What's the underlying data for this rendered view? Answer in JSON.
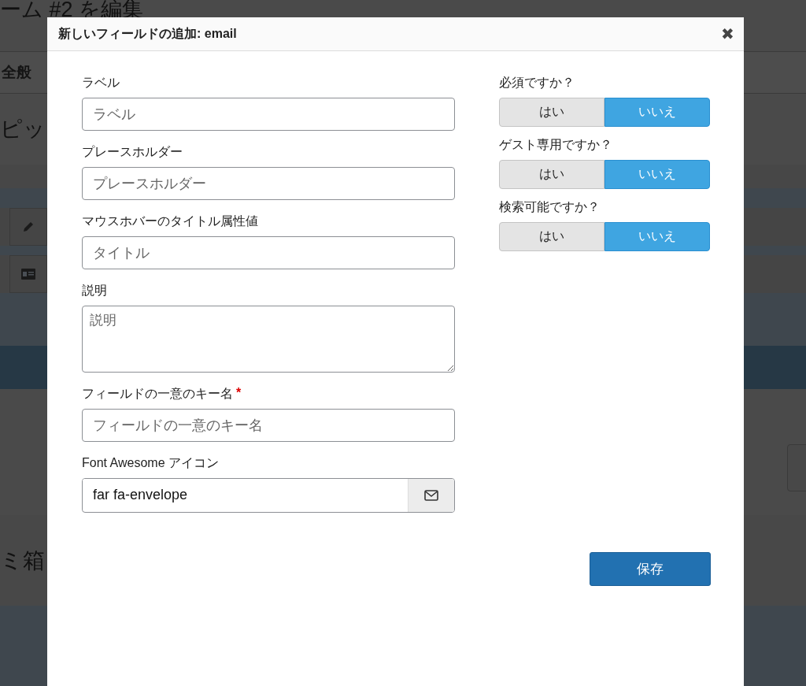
{
  "background": {
    "page_title": "ーム #2 を編集",
    "tab": "全般",
    "section_heading": "ピッ",
    "trash_heading": "ミ箱"
  },
  "dialog": {
    "title": "新しいフィールドの追加: email",
    "close": "✖",
    "fields": [
      {
        "kind": "input",
        "label": "ラベル",
        "placeholder": "ラベル"
      },
      {
        "kind": "input",
        "label": "プレースホルダー",
        "placeholder": "プレースホルダー"
      },
      {
        "kind": "input",
        "label": "マウスホバーのタイトル属性値",
        "placeholder": "タイトル"
      },
      {
        "kind": "textarea",
        "label": "説明",
        "placeholder": "説明"
      },
      {
        "kind": "input",
        "label": "フィールドの一意のキー名",
        "required_mark": "*",
        "placeholder": "フィールドの一意のキー名"
      },
      {
        "kind": "icon",
        "label": "Font Awesome アイコン",
        "value": "far fa-envelope"
      }
    ],
    "toggles": [
      {
        "label": "必須ですか？",
        "options": [
          {
            "text": "はい",
            "selected": false
          },
          {
            "text": "いいえ",
            "selected": true
          }
        ]
      },
      {
        "label": "ゲスト専用ですか？",
        "options": [
          {
            "text": "はい",
            "selected": false
          },
          {
            "text": "いいえ",
            "selected": true
          }
        ]
      },
      {
        "label": "検索可能ですか？",
        "options": [
          {
            "text": "はい",
            "selected": false
          },
          {
            "text": "いいえ",
            "selected": true
          }
        ]
      }
    ],
    "save_button": "保存"
  }
}
